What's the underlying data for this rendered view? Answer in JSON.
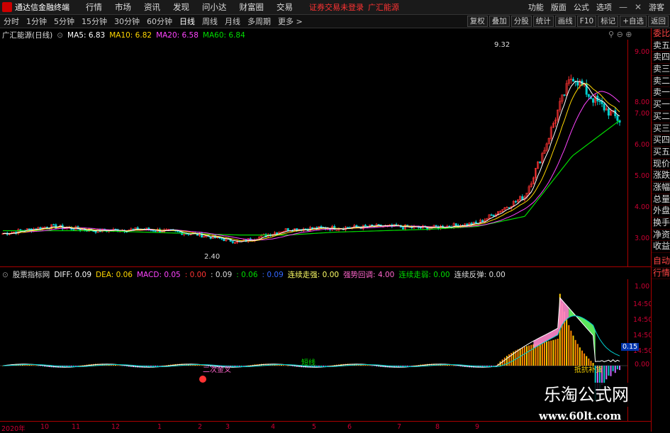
{
  "app": {
    "title": "通达信金融终端",
    "menus": [
      "行情",
      "市场",
      "资讯",
      "发现",
      "问小达",
      "财富圈",
      "交易"
    ],
    "alert": "证券交易未登录",
    "stock_name_top": "广汇能源",
    "right_menus": [
      "功能",
      "版面",
      "公式",
      "选项"
    ],
    "guest": "游客"
  },
  "periods": [
    "分时",
    "1分钟",
    "5分钟",
    "15分钟",
    "30分钟",
    "60分钟",
    "日线",
    "周线",
    "月线",
    "多周期",
    "更多 >"
  ],
  "active_period": "日线",
  "tools": [
    "复权",
    "叠加",
    "分股",
    "统计",
    "画线",
    "F10",
    "标记",
    "+自选",
    "返回"
  ],
  "main_header": {
    "title": "广汇能源(日线)",
    "ma5": "MA5: 6.83",
    "ma10": "MA10: 6.82",
    "ma20": "MA20: 6.58",
    "ma60": "MA60: 6.84"
  },
  "main_yaxis": [
    "9.00",
    "8.00",
    "7.00",
    "6.00",
    "5.00",
    "4.00",
    "3.00"
  ],
  "high_label": "9.32",
  "low_label": "2.40",
  "ind_header": {
    "name": "股票指标网",
    "diff": "DIFF: 0.09",
    "dea": "DEA: 0.06",
    "macd": "MACD: 0.05",
    "v1": ": 0.00",
    "v2": ": 0.09",
    "v3": ": 0.06",
    "v4": ": 0.09",
    "s1": "连续走强: 0.00",
    "s2": "强势回调: 4.00",
    "s3": "连续走弱: 0.00",
    "s4": "连续反弹: 0.00"
  },
  "ind_yaxis": [
    "1.00",
    "14:50",
    "14:50",
    "14:50",
    "14:50"
  ],
  "ind_value_tag": "0.15",
  "ind_zero": "0.00",
  "ind_labels": [
    "二次金叉",
    "短线",
    "抵抗补货"
  ],
  "x_labels": [
    "2020年",
    "10",
    "11",
    "12",
    "1",
    "2",
    "3",
    "4",
    "5",
    "6",
    "7",
    "8",
    "9"
  ],
  "side_items": [
    "委比",
    "卖五",
    "卖四",
    "卖三",
    "卖二",
    "卖一",
    "买一",
    "买二",
    "买三",
    "买四",
    "买五",
    "现价",
    "涨跌",
    "涨幅",
    "总量",
    "外盘",
    "换手",
    "净资",
    "收益",
    "自动",
    "行情"
  ],
  "watermark": {
    "line1": "乐淘公式网",
    "line2": "www.60lt.com"
  },
  "colors": {
    "up": "#ff3333",
    "down": "#00d0d0",
    "ma5": "#ffffff",
    "ma10": "#ffd700",
    "ma20": "#ff44ff",
    "ma60": "#00dd00",
    "axis": "#cc0033"
  },
  "chart_data": {
    "type": "line",
    "title": "广汇能源(日线)",
    "x": [
      "2020-09",
      "2020-10",
      "2020-11",
      "2020-12",
      "2021-01",
      "2021-02",
      "2021-03",
      "2021-04",
      "2021-05",
      "2021-06",
      "2021-07",
      "2021-08",
      "2021-09",
      "2021-10"
    ],
    "series": [
      {
        "name": "MA5",
        "values": [
          2.9,
          3.15,
          3.0,
          3.05,
          2.9,
          2.6,
          3.05,
          3.1,
          3.15,
          3.1,
          3.25,
          4.2,
          8.2,
          6.83
        ]
      },
      {
        "name": "MA60",
        "values": [
          3.0,
          3.0,
          3.0,
          2.95,
          2.9,
          2.85,
          2.85,
          2.95,
          3.0,
          3.05,
          3.15,
          3.5,
          5.6,
          6.84
        ]
      }
    ],
    "ylim": [
      2.2,
      9.6
    ]
  }
}
